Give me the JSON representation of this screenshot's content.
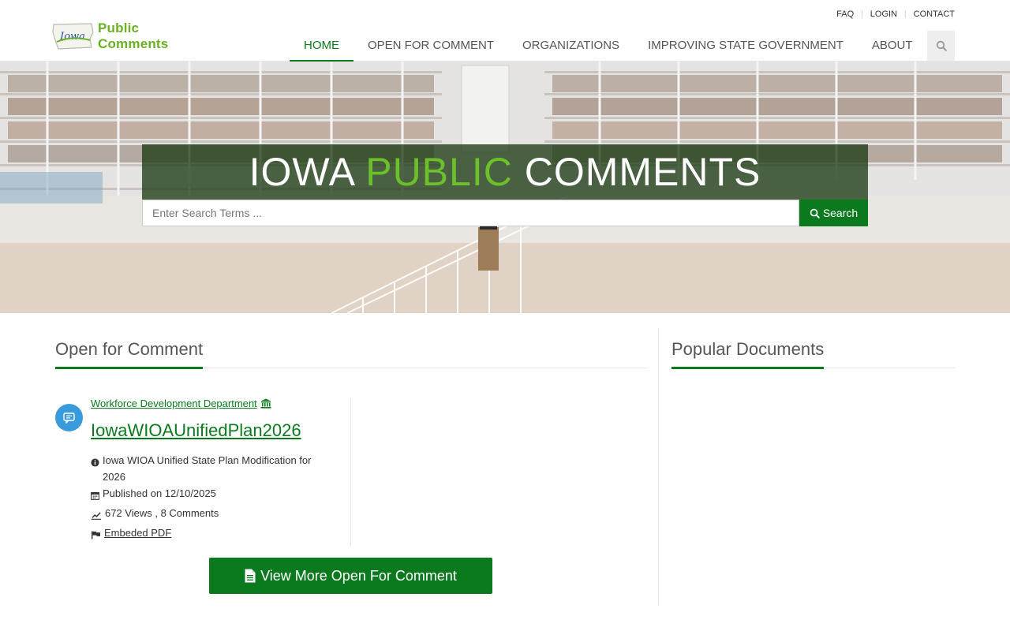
{
  "header": {
    "logo_state_word": "Iowa",
    "logo_text": "Public Comments",
    "util_nav": [
      "FAQ",
      "LOGIN",
      "CONTACT"
    ],
    "nav": [
      {
        "label": "HOME",
        "active": true
      },
      {
        "label": "OPEN FOR COMMENT",
        "active": false
      },
      {
        "label": "ORGANIZATIONS",
        "active": false
      },
      {
        "label": "IMPROVING STATE GOVERNMENT",
        "active": false
      },
      {
        "label": "ABOUT",
        "active": false
      }
    ],
    "search_icon": "search-icon"
  },
  "hero": {
    "title_part1": "IOWA",
    "title_part2": "PUBLIC",
    "title_part3": "COMMENTS",
    "search_placeholder": "Enter Search Terms ...",
    "search_button": "Search"
  },
  "open_for_comment": {
    "heading": "Open for Comment",
    "documents": [
      {
        "organization": "Workforce Development Department",
        "title": "IowaWIOAUnifiedPlan2026",
        "description": "Iowa WIOA Unified State Plan Modification for 2026",
        "published": "Published on 12/10/2025",
        "stats": "672 Views , 8 Comments",
        "link": "Embeded PDF"
      }
    ],
    "more_button": "View More Open For Comment"
  },
  "popular_documents": {
    "heading": "Popular Documents"
  },
  "colors": {
    "brand_green": "#0b7a1e",
    "accent_green": "#6cc12a",
    "icon_blue": "#3a9bdc"
  }
}
